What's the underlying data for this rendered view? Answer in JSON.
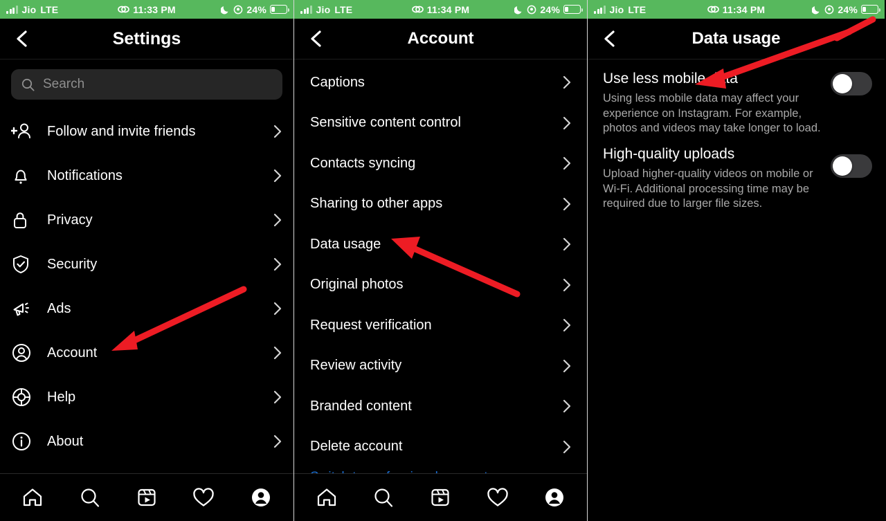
{
  "status_bar": {
    "carrier": "Jio",
    "network": "LTE",
    "time_left": "11:33 PM",
    "time_mid": "11:34 PM",
    "time_right": "11:34 PM",
    "battery_percent": "24%",
    "battery_level": 24,
    "moon_icon": "moon-icon",
    "location_icon": "location-icon",
    "screen_record_icon": "screen-record-icon",
    "signal_icon": "signal-bars-icon",
    "background_color": "#57b85d"
  },
  "panels": {
    "settings": {
      "title": "Settings",
      "back_icon": "chevron-left-icon",
      "search": {
        "placeholder": "Search",
        "icon": "search-icon",
        "value": ""
      },
      "items": [
        {
          "label": "Follow and invite friends",
          "icon": "person-add-icon"
        },
        {
          "label": "Notifications",
          "icon": "bell-icon"
        },
        {
          "label": "Privacy",
          "icon": "lock-icon"
        },
        {
          "label": "Security",
          "icon": "shield-check-icon"
        },
        {
          "label": "Ads",
          "icon": "megaphone-icon"
        },
        {
          "label": "Account",
          "icon": "account-circle-icon"
        },
        {
          "label": "Help",
          "icon": "lifebuoy-icon"
        },
        {
          "label": "About",
          "icon": "info-circle-icon"
        }
      ]
    },
    "account": {
      "title": "Account",
      "back_icon": "chevron-left-icon",
      "items": [
        {
          "label": "Captions"
        },
        {
          "label": "Sensitive content control"
        },
        {
          "label": "Contacts syncing"
        },
        {
          "label": "Sharing to other apps"
        },
        {
          "label": "Data usage"
        },
        {
          "label": "Original photos"
        },
        {
          "label": "Request verification"
        },
        {
          "label": "Review activity"
        },
        {
          "label": "Branded content"
        },
        {
          "label": "Delete account"
        }
      ],
      "link": "Switch to professional account"
    },
    "data_usage": {
      "title": "Data usage",
      "back_icon": "chevron-left-icon",
      "settings": [
        {
          "title": "Use less mobile data",
          "description": "Using less mobile data may affect your experience on Instagram. For example, photos and videos may take longer to load.",
          "toggle_state": "off"
        },
        {
          "title": "High-quality uploads",
          "description": "Upload higher-quality videos on mobile or Wi-Fi. Additional processing time may be required due to larger file sizes.",
          "toggle_state": "off"
        }
      ]
    }
  },
  "tabbar": {
    "items": [
      {
        "icon": "home-icon",
        "name": "home"
      },
      {
        "icon": "search-icon",
        "name": "search"
      },
      {
        "icon": "reels-icon",
        "name": "reels"
      },
      {
        "icon": "heart-icon",
        "name": "activity"
      },
      {
        "icon": "profile-avatar-icon",
        "name": "profile"
      }
    ]
  },
  "annotations": {
    "arrow_color": "#ed1c24",
    "arrows": [
      {
        "target": "Account",
        "panel": "settings"
      },
      {
        "target": "Data usage",
        "panel": "account"
      },
      {
        "target": "Use less mobile data",
        "panel": "data_usage"
      }
    ]
  }
}
